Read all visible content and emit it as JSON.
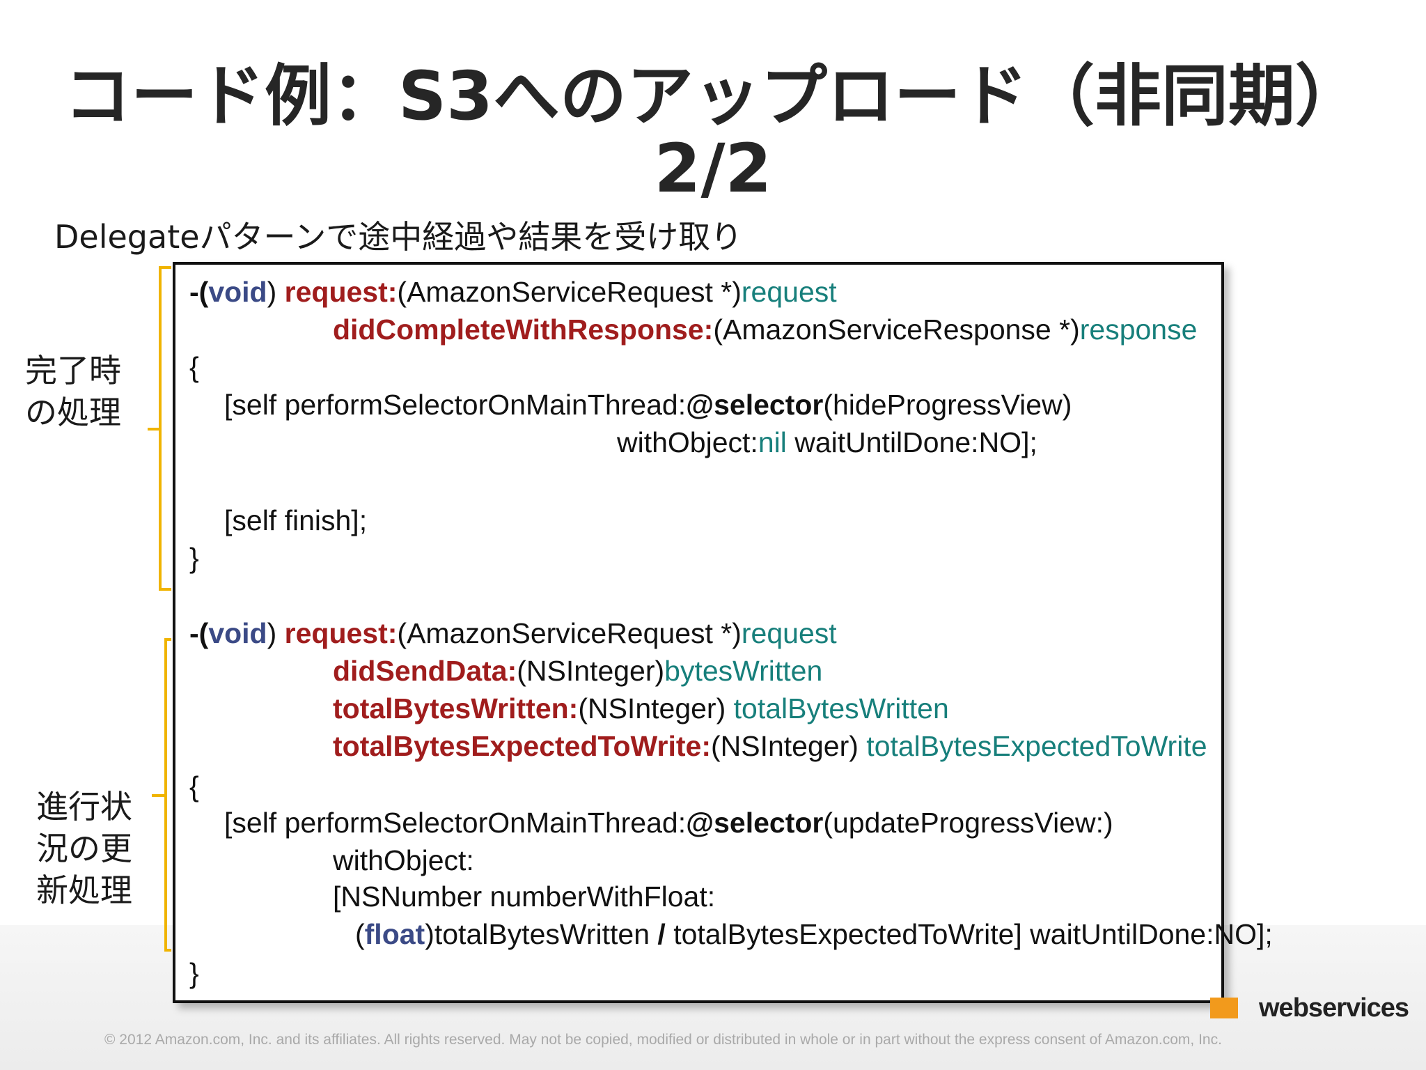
{
  "title": {
    "line1": "コード例：S3へのアップロード（非同期）",
    "line2": "2/2"
  },
  "subtitle": "Delegateパターンで途中経過や結果を受け取り",
  "side_labels": {
    "complete": [
      "完了時",
      "の処理"
    ],
    "progress": [
      "進行状",
      "況の更",
      "新処理"
    ]
  },
  "code": {
    "m1_l1": {
      "prefix": "-(",
      "kw": "void",
      "mid": ") ",
      "sel": "request:",
      "type": "(AmazonServiceRequest *)",
      "var": "request"
    },
    "m1_l2": {
      "sel": "didCompleteWithResponse:",
      "type": "(AmazonServiceResponse *)",
      "var": "response"
    },
    "m1_open": "{",
    "m1_l3": {
      "a": "[self performSelectorOnMainThread:",
      "b": "@selector",
      "c": "(hideProgressView)"
    },
    "m1_l4": {
      "a": "withObject:",
      "b": "nil",
      "c": " waitUntilDone:NO];"
    },
    "m1_l5": "[self finish];",
    "m1_close": "}",
    "m2_l1": {
      "prefix": "-(",
      "kw": "void",
      "mid": ") ",
      "sel": "request:",
      "type": "(AmazonServiceRequest *)",
      "var": "request"
    },
    "m2_l2": {
      "sel": "didSendData:",
      "type": "(NSInteger)",
      "var": "bytesWritten"
    },
    "m2_l3": {
      "sel": "totalBytesWritten:",
      "type": "(NSInteger) ",
      "var": "totalBytesWritten"
    },
    "m2_l4": {
      "sel": "totalBytesExpectedToWrite:",
      "type": "(NSInteger) ",
      "var": "totalBytesExpectedToWrite"
    },
    "m2_open": "{",
    "m2_l5": {
      "a": "[self performSelectorOnMainThread:",
      "b": "@selector",
      "c": "(updateProgressView:)"
    },
    "m2_l6": "withObject:",
    "m2_l7": "[NSNumber numberWithFloat:",
    "m2_l8": {
      "a": "(",
      "b": "float",
      "c": ")totalBytesWritten ",
      "d": "/",
      "e": " totalBytesExpectedToWrite] waitUntilDone:NO];"
    },
    "m2_close": "}"
  },
  "footer": {
    "copyright": "© 2012 Amazon.com, Inc. and its affiliates.  All rights reserved.  May not be copied, modified or distributed in whole or in part without the express consent of Amazon.com, Inc.",
    "logo_text": "webservices"
  },
  "colors": {
    "keyword": "#3b4a86",
    "selector": "#a01d1d",
    "variable": "#177f7b",
    "bracket": "#f0b400"
  }
}
